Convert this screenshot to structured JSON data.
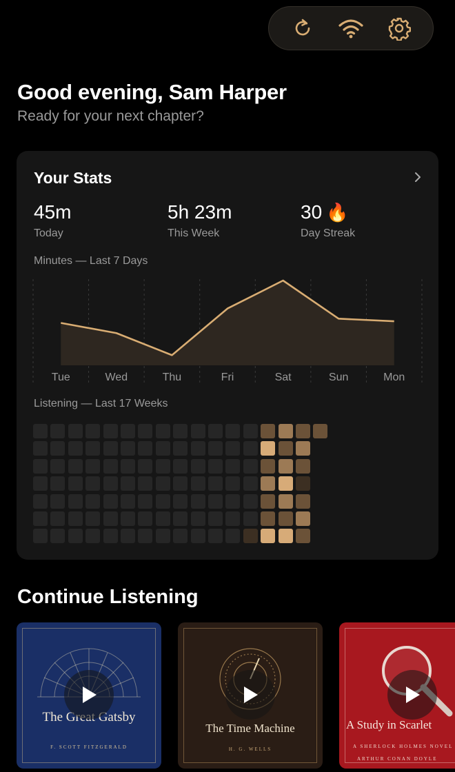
{
  "toolbar": {
    "icons": [
      "refresh-icon",
      "wifi-icon",
      "gear-icon"
    ],
    "accent": "#d9ad73"
  },
  "greeting": {
    "title": "Good evening, Sam Harper",
    "subtitle": "Ready for your next chapter?"
  },
  "stats": {
    "title": "Your Stats",
    "items": [
      {
        "value": "45m",
        "label": "Today"
      },
      {
        "value": "5h 23m",
        "label": "This Week"
      },
      {
        "value": "30",
        "label": "Day Streak",
        "icon": "🔥"
      }
    ],
    "minutes_label": "Minutes — Last 7 Days",
    "listening_label": "Listening — Last 17 Weeks"
  },
  "chart_data": {
    "type": "area",
    "title": "Minutes — Last 7 Days",
    "categories": [
      "Tue",
      "Wed",
      "Thu",
      "Fri",
      "Sat",
      "Sun",
      "Mon"
    ],
    "values": [
      50,
      38,
      12,
      67,
      100,
      55,
      52
    ],
    "ylim": [
      0,
      100
    ],
    "grid": "vertical-dashed",
    "line_color": "#d9ad73"
  },
  "heatmap": {
    "weeks": 17,
    "days": 7,
    "levels": [
      [
        0,
        0,
        0,
        0,
        0,
        0,
        0
      ],
      [
        0,
        0,
        0,
        0,
        0,
        0,
        0
      ],
      [
        0,
        0,
        0,
        0,
        0,
        0,
        0
      ],
      [
        0,
        0,
        0,
        0,
        0,
        0,
        0
      ],
      [
        0,
        0,
        0,
        0,
        0,
        0,
        0
      ],
      [
        0,
        0,
        0,
        0,
        0,
        0,
        0
      ],
      [
        0,
        0,
        0,
        0,
        0,
        0,
        0
      ],
      [
        0,
        0,
        0,
        0,
        0,
        0,
        0
      ],
      [
        0,
        0,
        0,
        0,
        0,
        0,
        0
      ],
      [
        0,
        0,
        0,
        0,
        0,
        0,
        0
      ],
      [
        0,
        0,
        0,
        0,
        0,
        0,
        0
      ],
      [
        0,
        0,
        0,
        0,
        0,
        0,
        0
      ],
      [
        0,
        0,
        0,
        0,
        0,
        0,
        1
      ],
      [
        2,
        4,
        2,
        3,
        2,
        2,
        4
      ],
      [
        3,
        2,
        3,
        4,
        3,
        2,
        4
      ],
      [
        2,
        3,
        2,
        1,
        2,
        3,
        2
      ],
      [
        2
      ]
    ],
    "colors": [
      "#262626",
      "#3c2f22",
      "#6b5238",
      "#9c7a55",
      "#d7ab78"
    ]
  },
  "continue": {
    "title": "Continue Listening",
    "books": [
      {
        "title": "The Great Gatsby",
        "author": "F. SCOTT FITZGERALD"
      },
      {
        "title": "The Time Machine",
        "author": "H. G. WELLS"
      },
      {
        "title": "A Study in Scarlet",
        "subtitle": "A SHERLOCK HOLMES NOVEL",
        "author": "ARTHUR CONAN DOYLE"
      }
    ]
  }
}
